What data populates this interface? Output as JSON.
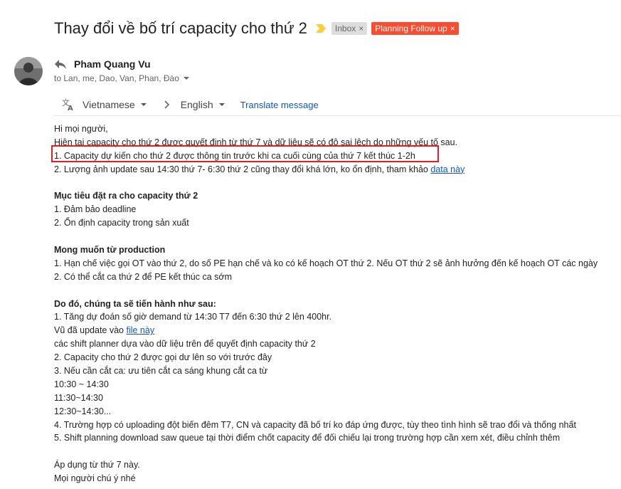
{
  "subject": "Thay đổi về bố trí capacity cho thứ 2",
  "labels": {
    "inbox": "Inbox",
    "planning": "Planning Follow up",
    "remove_glyph": "×"
  },
  "colors": {
    "planning_chip": "#fb4c2f",
    "importance_marker": "#f4d03f",
    "highlight_box": "#e02020",
    "link": "#1155cc"
  },
  "sender": {
    "name": "Pham Quang Vu",
    "recipients": "to Lan, me, Dao, Van, Phan, Đào"
  },
  "translate": {
    "from": "Vietnamese",
    "to": "English",
    "link": "Translate message"
  },
  "body": {
    "greeting": "Hi mọi người,",
    "intro": "Hiện tại capacity cho thứ 2 được quyết định từ thứ 7 và dữ liệu sẽ có độ sai lệch do những yếu tố sau.",
    "reason1": "1. Capacity dự kiến cho thứ 2 được thông tin trước khi ca cuối cùng của thứ 7 kết thúc 1-2h",
    "reason2_text": "2. Lượng ảnh update sau 14:30 thứ 7- 6:30 thứ 2 cũng thay đổi khá lớn, ko ổn định, tham khảo ",
    "reason2_link": "data này",
    "goals_heading": "Mục tiêu đặt ra cho capacity thứ 2",
    "goal1": "1. Đảm bảo deadline",
    "goal2": "2. Ổn định capacity trong sản xuất",
    "wishes_heading": "Mong muốn từ production",
    "wish1": "1. Hạn chế việc  gọi OT vào thứ 2, do số PE hạn chế và ko có kế hoạch OT thứ 2. Nếu OT thứ 2 sẽ ảnh hưởng đến kế hoạch OT các ngày",
    "wish2": "2. Có thể cắt ca thứ 2 để PE kết thúc ca sớm",
    "actions_heading": "Do đó, chúng ta sẽ tiến hành như sau:",
    "action1": "1. Tăng dự đoán số  giờ demand từ 14:30 T7 đến 6:30 thứ 2 lên 400hr.",
    "action1_sub1_text": "Vũ đã update vào ",
    "action1_sub1_link": "file này ",
    "action1_sub2": "các  shift planner dựa vào dữ liệu trên để quyết định capacity thứ 2",
    "action2": "2. Capacity cho thứ 2 được gọi dư lên so với trước đây",
    "action3": "3. Nếu cần cắt ca: ưu tiên cắt ca sáng khung cắt ca từ",
    "time1": "10:30 ~ 14:30",
    "time2": "11:30~14:30",
    "time3": "12:30~14:30...",
    "action4": "4. Trường hợp có uploading đột biến đêm T7, CN và capacity đã bố trí ko đáp ứng được, tùy theo tình hình sẽ trao đổi và thống nhất",
    "action5": "5. Shift planning download saw queue tại thời điểm chốt capacity để đối chiếu lại trong trường hợp cần xem xét, điều chỉnh thêm",
    "closing1": "Áp dụng từ thứ 7 này.",
    "closing2": "Mọi người chú ý nhé"
  }
}
